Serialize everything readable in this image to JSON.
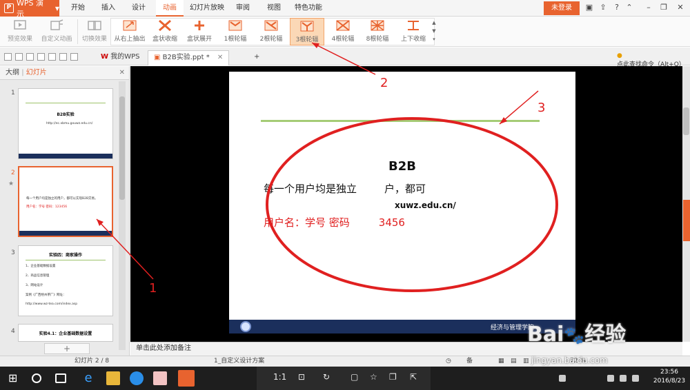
{
  "app": {
    "name": "WPS 演示"
  },
  "menu": {
    "tabs": [
      "开始",
      "插入",
      "设计",
      "动画",
      "幻灯片放映",
      "审阅",
      "视图",
      "特色功能"
    ],
    "active": "动画",
    "login": "未登录"
  },
  "ribbon": {
    "left": [
      {
        "label": "预览效果",
        "icon": "preview-icon",
        "disabled": true
      },
      {
        "label": "自定义动画",
        "icon": "custom-animation-icon",
        "disabled": true
      },
      {
        "label": "切换效果",
        "icon": "transition-icon",
        "disabled": true
      }
    ],
    "gallery": [
      {
        "label": "从右上抽出",
        "icon": "pull-out-icon"
      },
      {
        "label": "盒状收缩",
        "icon": "box-shrink-icon"
      },
      {
        "label": "盒状展开",
        "icon": "box-expand-icon"
      },
      {
        "label": "1根轮辐",
        "icon": "wheel-1-icon"
      },
      {
        "label": "2根轮辐",
        "icon": "wheel-2-icon"
      },
      {
        "label": "3根轮辐",
        "icon": "wheel-3-icon",
        "selected": true
      },
      {
        "label": "4根轮辐",
        "icon": "wheel-4-icon"
      },
      {
        "label": "8根轮辐",
        "icon": "wheel-8-icon"
      },
      {
        "label": "上下收缩",
        "icon": "vertical-shrink-icon"
      }
    ]
  },
  "doctabs": {
    "home": "我的WPS",
    "file": "B2B实验.ppt *",
    "help": "点此查找命令（Alt+Q）"
  },
  "leftpane": {
    "tabs": [
      "大纲",
      "幻灯片"
    ],
    "active": "幻灯片",
    "slides": [
      {
        "num": "1",
        "title": "B2B实验",
        "line": "http://ec.xbmu.gxuwz.edu.cn/"
      },
      {
        "num": "2",
        "line1": "每一个用户均是独立的用户，都可以实现B2B交易。",
        "line2": "用户名：学号  密码：123456"
      },
      {
        "num": "3",
        "title": "实验四：商家操作",
        "items": [
          "1、企业基础数据设置",
          "2、商品信息管理",
          "3、网站设计",
          "案例《广西梧州茶厂》网址：",
          "http://www.wz-tea.com/index.asp"
        ]
      },
      {
        "num": "4",
        "title": "实验4.1：企业基础数据设置"
      }
    ]
  },
  "slide": {
    "title": "B2B",
    "body": "每一个用户均是独立",
    "body_tail": "户，都可",
    "url": "xuwz.edu.cn/",
    "red_line": "用户名：学号  密码",
    "red_tail": "3456",
    "footer": "经济与管理学院"
  },
  "notes": "单击此处添加备注",
  "status": {
    "slide": "幻灯片 2 / 8",
    "template": "1_自定义设计方案",
    "notes": "备注",
    "zoom": "72 %"
  },
  "floatbar": {
    "ratio": "1:1"
  },
  "clock": {
    "time": "23:56",
    "date": "2016/8/23"
  },
  "watermark": {
    "brand": "Bai",
    "brand2": "经验",
    "url": "jingyan.baidu.com"
  },
  "annotations": {
    "n1": "1",
    "n2": "2",
    "n3": "3"
  },
  "colors": {
    "accent": "#e8632f",
    "annotation": "#e02020",
    "slide_bar": "#1b2f5c",
    "slide_line": "#a5cc76"
  }
}
